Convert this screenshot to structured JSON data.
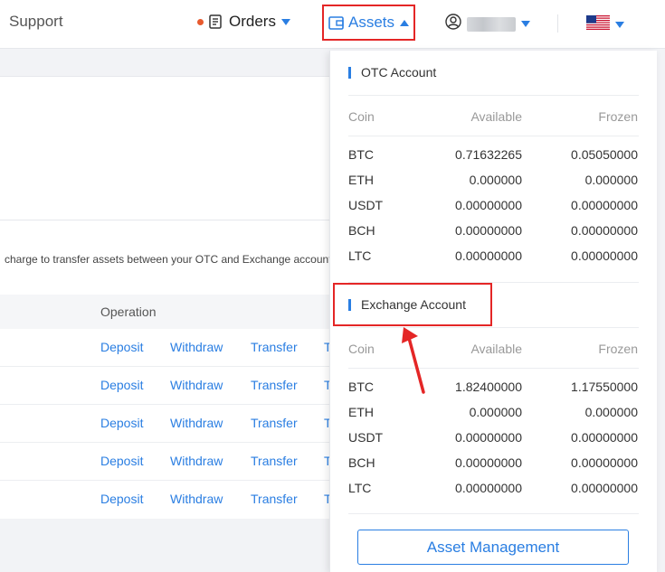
{
  "header": {
    "support_label": "Support",
    "orders_label": "Orders",
    "assets_label": "Assets",
    "status_dot_color": "#e85a2e",
    "accent_color": "#2a7ee2",
    "highlight_color": "#e42626"
  },
  "main": {
    "hint_text": "charge to transfer assets between your OTC and Exchange account",
    "operation_header": "Operation",
    "rows": [
      {
        "deposit": "Deposit",
        "withdraw": "Withdraw",
        "transfer": "Transfer",
        "trade": "T"
      },
      {
        "deposit": "Deposit",
        "withdraw": "Withdraw",
        "transfer": "Transfer",
        "trade": "T"
      },
      {
        "deposit": "Deposit",
        "withdraw": "Withdraw",
        "transfer": "Transfer",
        "trade": "T"
      },
      {
        "deposit": "Deposit",
        "withdraw": "Withdraw",
        "transfer": "Transfer",
        "trade": "T"
      },
      {
        "deposit": "Deposit",
        "withdraw": "Withdraw",
        "transfer": "Transfer",
        "trade": "T"
      }
    ]
  },
  "assets_dropdown": {
    "otc": {
      "title": "OTC Account",
      "columns": {
        "coin": "Coin",
        "available": "Available",
        "frozen": "Frozen"
      },
      "rows": [
        {
          "coin": "BTC",
          "available": "0.71632265",
          "frozen": "0.05050000"
        },
        {
          "coin": "ETH",
          "available": "0.000000",
          "frozen": "0.000000"
        },
        {
          "coin": "USDT",
          "available": "0.00000000",
          "frozen": "0.00000000"
        },
        {
          "coin": "BCH",
          "available": "0.00000000",
          "frozen": "0.00000000"
        },
        {
          "coin": "LTC",
          "available": "0.00000000",
          "frozen": "0.00000000"
        }
      ]
    },
    "exchange": {
      "title": "Exchange Account",
      "columns": {
        "coin": "Coin",
        "available": "Available",
        "frozen": "Frozen"
      },
      "rows": [
        {
          "coin": "BTC",
          "available": "1.82400000",
          "frozen": "1.17550000"
        },
        {
          "coin": "ETH",
          "available": "0.000000",
          "frozen": "0.000000"
        },
        {
          "coin": "USDT",
          "available": "0.00000000",
          "frozen": "0.00000000"
        },
        {
          "coin": "BCH",
          "available": "0.00000000",
          "frozen": "0.00000000"
        },
        {
          "coin": "LTC",
          "available": "0.00000000",
          "frozen": "0.00000000"
        }
      ]
    },
    "asset_management_label": "Asset Management"
  },
  "icons": [
    "orders-doc-icon",
    "wallet-icon",
    "user-icon",
    "us-flag-icon",
    "red-arrow-icon"
  ]
}
